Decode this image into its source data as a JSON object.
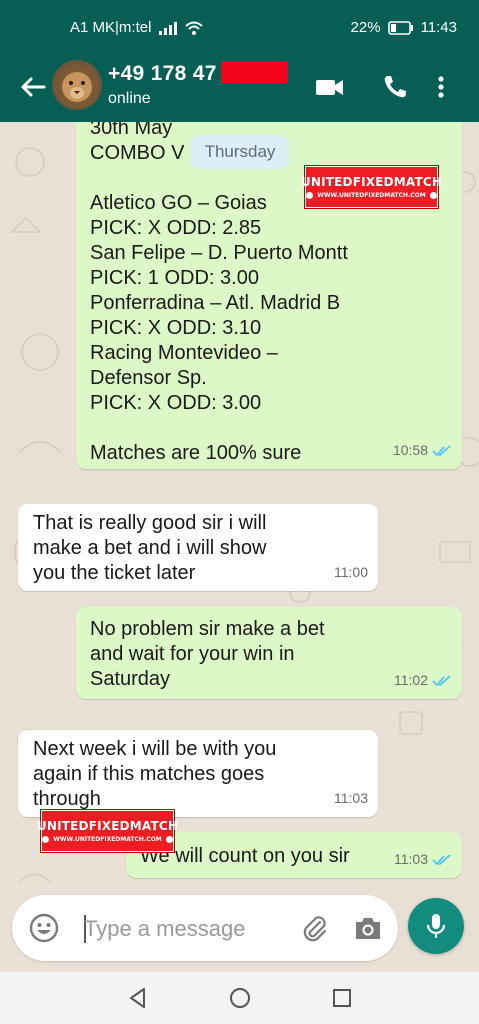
{
  "status_bar": {
    "carrier": "A1 MK|m:tel",
    "battery": "22%",
    "time": "11:43"
  },
  "header": {
    "contact_name": "+49 178 47",
    "contact_status": "online",
    "icons": [
      "back-arrow-icon",
      "avatar-lion",
      "video-call-icon",
      "phone-icon",
      "more-vert-icon"
    ]
  },
  "chat": {
    "day_label": "Thursday",
    "messages": [
      {
        "direction": "outgoing",
        "lines": [
          "30th May",
          "COMBO V",
          "",
          "Atletico GO – Goias",
          "PICK: X ODD: 2.85",
          "San Felipe – D. Puerto Montt",
          "PICK: 1 ODD: 3.00",
          "Ponferradina – Atl. Madrid B",
          "PICK: X ODD: 3.10",
          "Racing Montevideo –",
          "Defensor Sp.",
          "PICK: X ODD: 3.00",
          "",
          "Matches are 100% sure"
        ],
        "time": "10:58",
        "status": "read"
      },
      {
        "direction": "incoming",
        "lines": [
          "That is really good sir i will",
          "make a bet and i will show",
          "you the ticket later"
        ],
        "time": "11:00"
      },
      {
        "direction": "outgoing",
        "lines": [
          "No problem sir make a bet",
          "and wait for your win in",
          "Saturday"
        ],
        "time": "11:02",
        "status": "read"
      },
      {
        "direction": "incoming",
        "lines": [
          "Next week i will be with you",
          "again if this matches goes",
          "through"
        ],
        "time": "11:03"
      },
      {
        "direction": "outgoing",
        "lines": [
          "We will count on you sir"
        ],
        "time": "11:03",
        "status": "read"
      }
    ]
  },
  "watermark": {
    "title": "UNITEDFIXEDMATCH",
    "url": "WWW.UNITEDFIXEDMATCH.COM"
  },
  "composer": {
    "placeholder": "Type a message"
  },
  "colors": {
    "header": "#075e54",
    "outgoing_bubble": "#dcf8c6",
    "incoming_bubble": "#ffffff",
    "read_ticks": "#4fc3f7",
    "mic_button": "#128c7e",
    "watermark": "#ee1c23"
  }
}
